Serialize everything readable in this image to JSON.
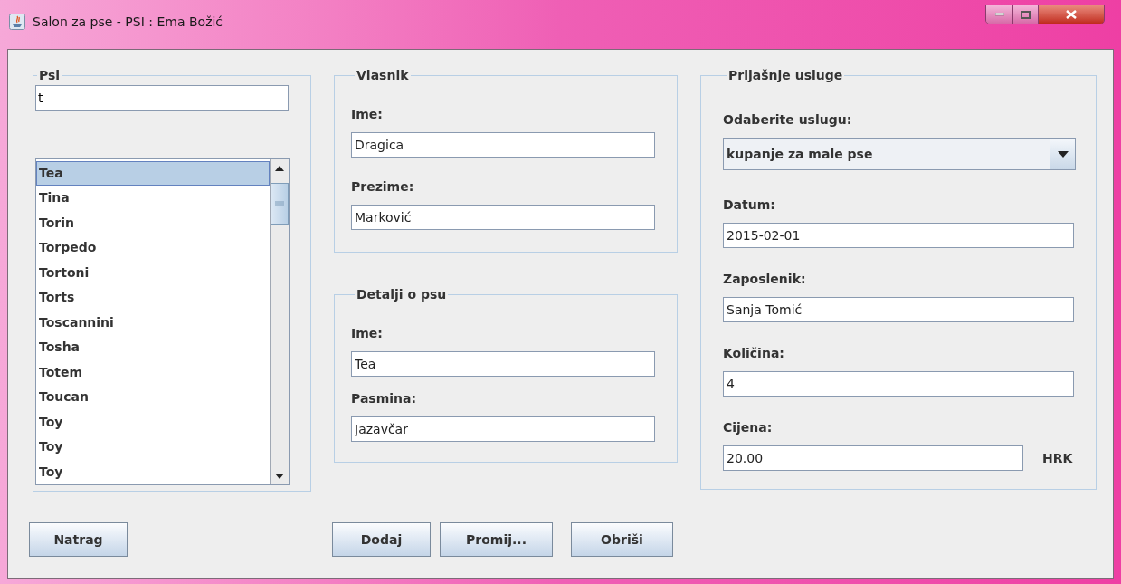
{
  "window": {
    "title": "Salon za pse - PSI : Ema Božić"
  },
  "dogs": {
    "legend": "Psi",
    "search_value": "t",
    "items": [
      {
        "label": "Tea",
        "selected": true
      },
      {
        "label": "Tina",
        "selected": false
      },
      {
        "label": "Torin",
        "selected": false
      },
      {
        "label": "Torpedo",
        "selected": false
      },
      {
        "label": "Tortoni",
        "selected": false
      },
      {
        "label": "Torts",
        "selected": false
      },
      {
        "label": "Toscannini",
        "selected": false
      },
      {
        "label": "Tosha",
        "selected": false
      },
      {
        "label": "Totem",
        "selected": false
      },
      {
        "label": "Toucan",
        "selected": false
      },
      {
        "label": "Toy",
        "selected": false
      },
      {
        "label": "Toy",
        "selected": false
      },
      {
        "label": "Toy",
        "selected": false
      }
    ]
  },
  "owner": {
    "legend": "Vlasnik",
    "fields": [
      {
        "label": "Ime:",
        "value": "Dragica"
      },
      {
        "label": "Prezime:",
        "value": "Marković"
      }
    ]
  },
  "dog_details": {
    "legend": "Detalji o psu",
    "fields": [
      {
        "label": "Ime:",
        "value": "Tea"
      },
      {
        "label": "Pasmina:",
        "value": "Jazavčar"
      }
    ]
  },
  "past_services": {
    "legend": "Prijašnje usluge",
    "fields": [
      {
        "kind": "combo",
        "label": "Odaberite uslugu:",
        "value": "kupanje za male pse"
      },
      {
        "kind": "text",
        "label": "Datum:",
        "value": "2015-02-01"
      },
      {
        "kind": "text",
        "label": "Zaposlenik:",
        "value": "Sanja Tomić"
      },
      {
        "kind": "text",
        "label": "Količina:",
        "value": "4"
      },
      {
        "kind": "unit",
        "label": "Cijena:",
        "value": "20.00",
        "unit": "HRK"
      }
    ]
  },
  "buttons_left": [
    "Natrag"
  ],
  "buttons_center": [
    "Dodaj",
    "Promij...",
    "Obriši"
  ]
}
